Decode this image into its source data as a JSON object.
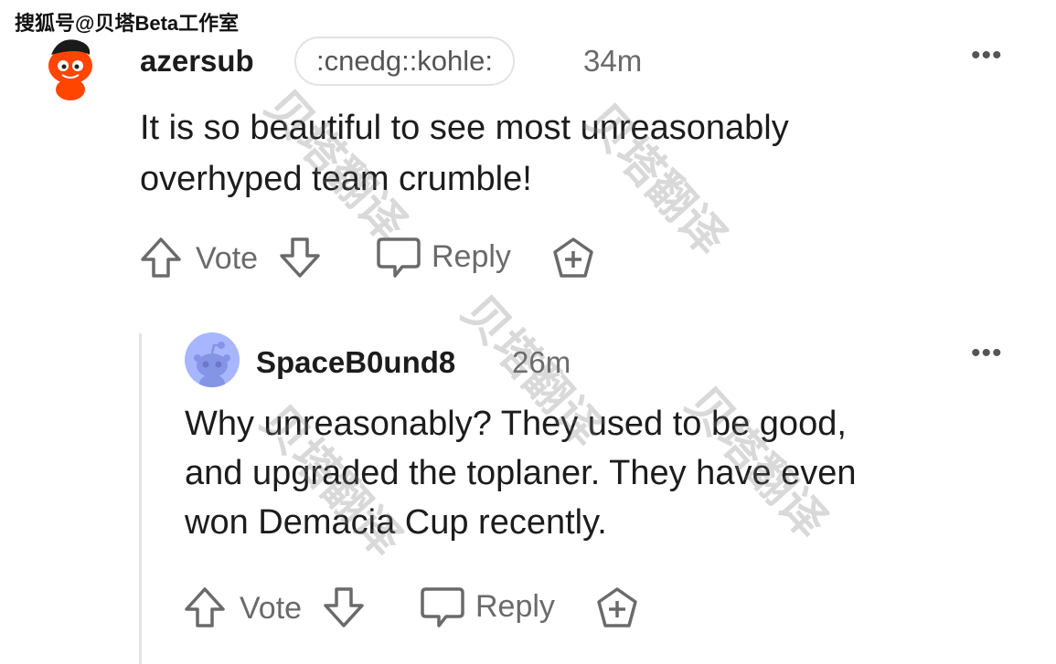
{
  "source_tag": "搜狐号@贝塔Beta工作室",
  "watermark_text": "贝塔翻译",
  "comments": [
    {
      "username": "azersub",
      "flair": ":cnedg::kohle:",
      "time": "34m",
      "more": "•••",
      "body_lines": [
        "It is so beautiful to see most unreasonably",
        "overhyped team crumble!"
      ],
      "vote_label": "Vote",
      "reply_label": "Reply"
    },
    {
      "username": "SpaceB0und8",
      "time": "26m",
      "more": "•••",
      "body_lines": [
        "Why unreasonably? They used to be good,",
        "and upgraded the toplaner. They have even",
        "won Demacia Cup recently."
      ],
      "vote_label": "Vote",
      "reply_label": "Reply"
    }
  ],
  "colors": {
    "avatar1_bg": "#ff4500",
    "avatar2_bg": "#a7b6ff",
    "icon_gray": "#6a6a6a"
  }
}
